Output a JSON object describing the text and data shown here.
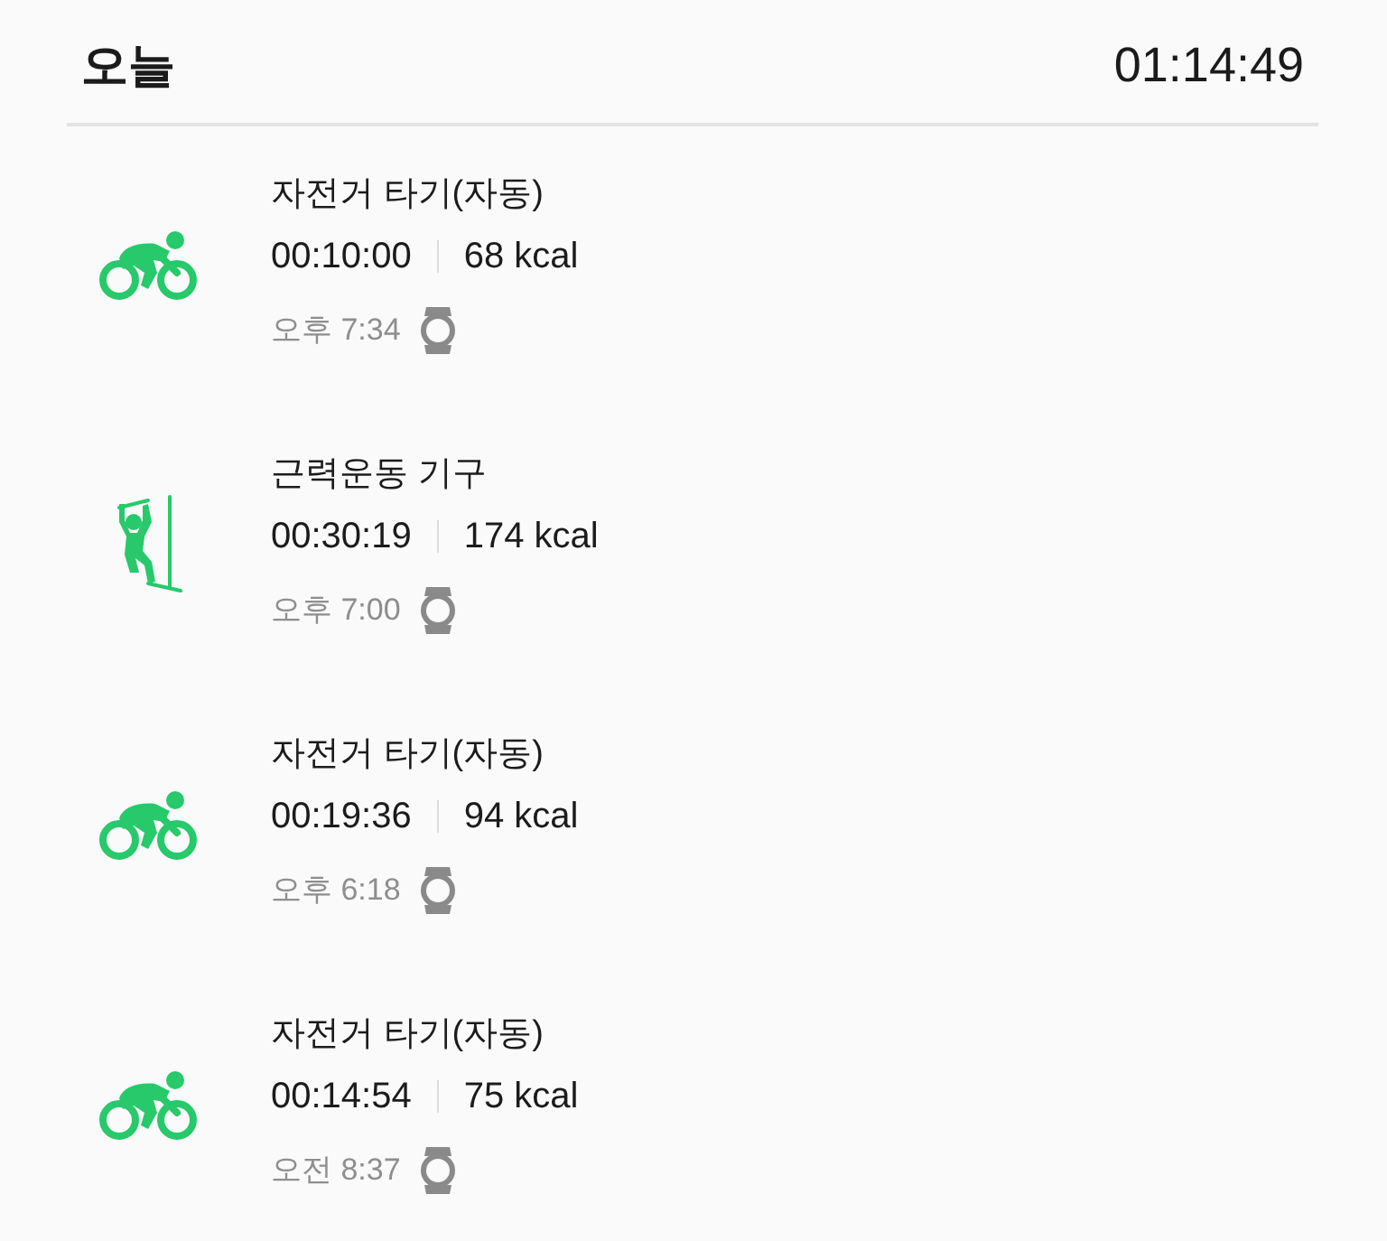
{
  "header": {
    "title": "오늘",
    "total_duration": "01:14:49"
  },
  "workouts": [
    {
      "kind": "cycling",
      "name": "자전거 타기(자동)",
      "duration": "00:10:00",
      "calories": "68 kcal",
      "start_time": "오후 7:34"
    },
    {
      "kind": "strength",
      "name": "근력운동 기구",
      "duration": "00:30:19",
      "calories": "174 kcal",
      "start_time": "오후 7:00"
    },
    {
      "kind": "cycling",
      "name": "자전거 타기(자동)",
      "duration": "00:19:36",
      "calories": "94 kcal",
      "start_time": "오후 6:18"
    },
    {
      "kind": "cycling",
      "name": "자전거 타기(자동)",
      "duration": "00:14:54",
      "calories": "75 kcal",
      "start_time": "오전 8:37"
    }
  ]
}
